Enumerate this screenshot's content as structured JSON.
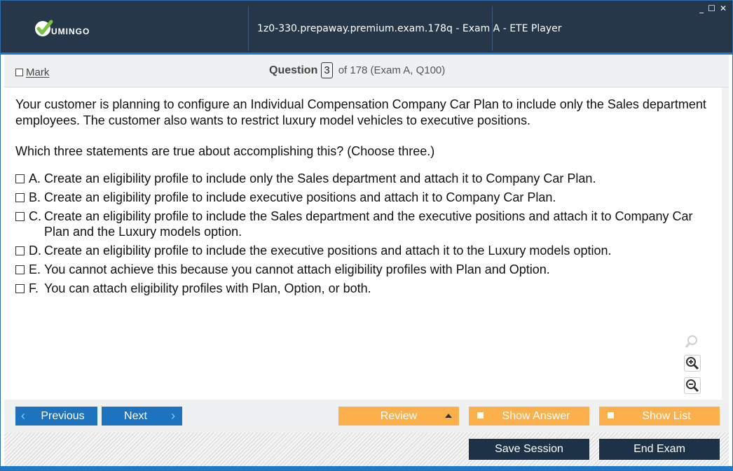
{
  "app": {
    "logo_text": "UMINGO",
    "title": "1z0-330.prepaway.premium.exam.178q - Exam A - ETE Player",
    "window_controls": [
      "_",
      "☐",
      "✕"
    ]
  },
  "question_bar": {
    "mark_label": "Mark",
    "question_label": "Question",
    "question_number": "3",
    "question_rest": "of 178 (Exam A, Q100)"
  },
  "question": {
    "text": "Your customer is planning to configure an Individual Compensation Company Car Plan to include only the Sales department employees. The customer also wants to restrict luxury model vehicles to executive positions.",
    "prompt": "Which three statements are true about accomplishing this? (Choose three.)",
    "options": [
      {
        "letter": "A.",
        "text": "Create an eligibility profile to include only the Sales department and attach it to Company Car Plan."
      },
      {
        "letter": "B.",
        "text": "Create an eligibility profile to include executive positions and attach it to Company Car Plan."
      },
      {
        "letter": "C.",
        "text": "Create an eligibility profile to include the Sales department and the executive positions and attach it to Company Car Plan and the Luxury models option."
      },
      {
        "letter": "D.",
        "text": "Create an eligibility profile to include the executive positions and attach it to the Luxury models option."
      },
      {
        "letter": "E.",
        "text": "You cannot achieve this because you cannot attach eligibility profiles with Plan and Option."
      },
      {
        "letter": "F.",
        "text": "You can attach eligibility profiles with Plan, Option, or both."
      }
    ]
  },
  "nav": {
    "previous_label": "Previous",
    "next_label": "Next",
    "review_label": "Review",
    "show_answer_label": "Show Answer",
    "show_list_label": "Show List",
    "save_session_label": "Save Session",
    "end_exam_label": "End Exam"
  },
  "colors": {
    "title_bg": "#253749",
    "accent_blue": "#1e73be",
    "orange": "#fbb04b",
    "dark_button": "#1e3247"
  },
  "icons": [
    "check-logo-icon",
    "zoom-fit-icon",
    "zoom-in-icon",
    "zoom-out-icon",
    "chevron-left-icon",
    "chevron-right-icon",
    "triangle-up-icon"
  ]
}
